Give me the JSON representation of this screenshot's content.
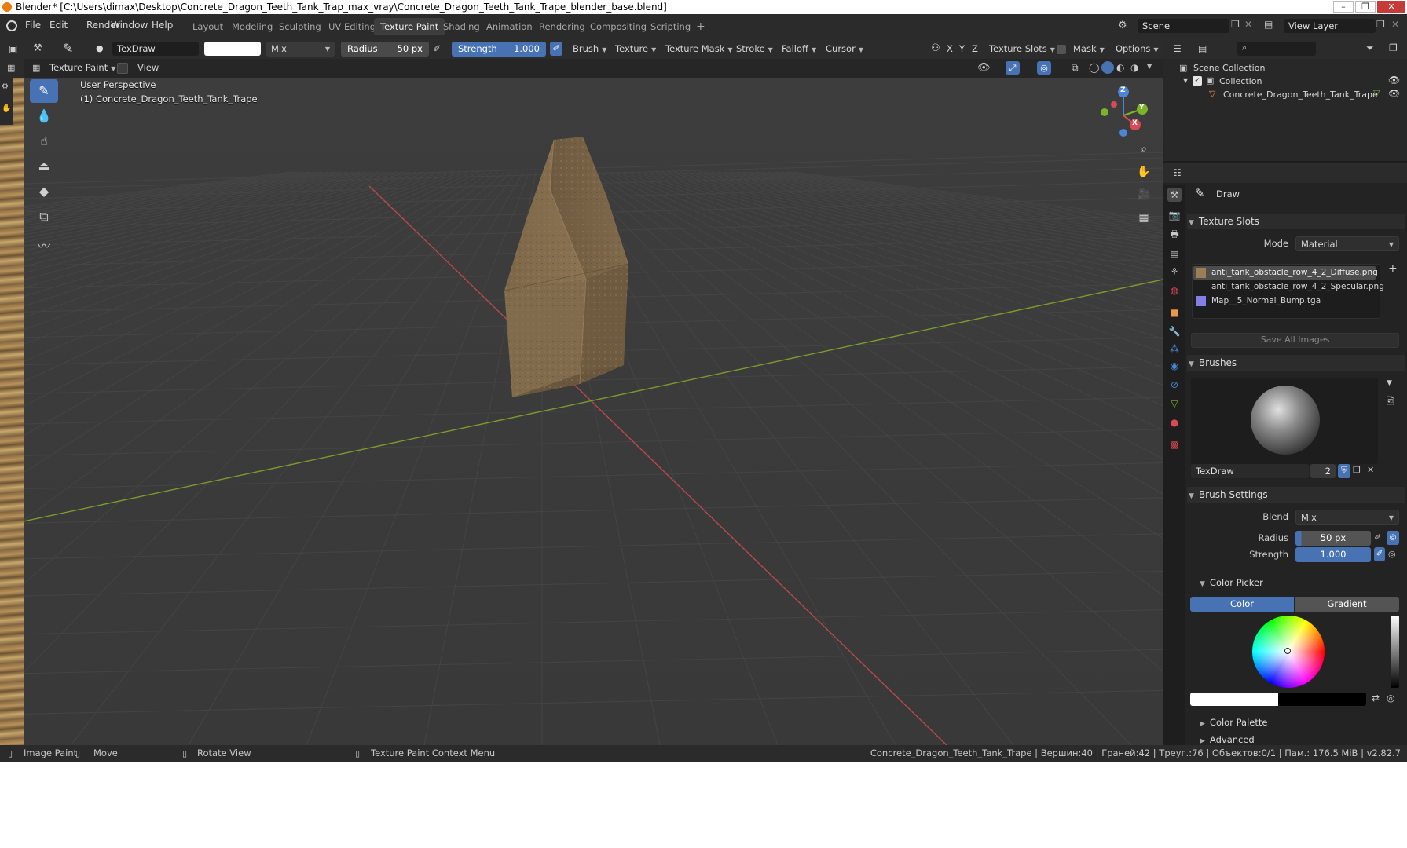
{
  "titlebar": {
    "title": "Blender* [C:\\Users\\dimax\\Desktop\\Concrete_Dragon_Teeth_Tank_Trap_max_vray\\Concrete_Dragon_Teeth_Tank_Trape_blender_base.blend]"
  },
  "menu": {
    "file": "File",
    "edit": "Edit",
    "render": "Render",
    "window": "Window",
    "help": "Help"
  },
  "workspaces": [
    "Layout",
    "Modeling",
    "Sculpting",
    "UV Editing",
    "Texture Paint",
    "Shading",
    "Animation",
    "Rendering",
    "Compositing",
    "Scripting"
  ],
  "workspace_add": "+",
  "scene": {
    "name": "Scene",
    "view_layer": "View Layer"
  },
  "tool_header": {
    "brush_name": "TexDraw",
    "blend": "Mix",
    "radius_label": "Radius",
    "radius_value": "50 px",
    "strength_label": "Strength",
    "strength_value": "1.000",
    "brush": "Brush",
    "texture": "Texture",
    "texture_mask": "Texture Mask",
    "stroke": "Stroke",
    "falloff": "Falloff",
    "cursor": "Cursor",
    "axis_x": "X",
    "axis_y": "Y",
    "axis_z": "Z",
    "texture_slots": "Texture Slots",
    "mask": "Mask",
    "options": "Options"
  },
  "viewport_header": {
    "mode": "Texture Paint",
    "view": "View"
  },
  "viewport": {
    "perspective": "User Perspective",
    "object_label": "(1) Concrete_Dragon_Teeth_Tank_Trape"
  },
  "gizmo": {
    "x": "X",
    "y": "Y",
    "z": "Z"
  },
  "outliner": {
    "scene_collection": "Scene Collection",
    "collection": "Collection",
    "object": "Concrete_Dragon_Teeth_Tank_Trape"
  },
  "properties": {
    "tool_name": "Draw",
    "texture_slots_title": "Texture Slots",
    "mode_label": "Mode",
    "mode_value": "Material",
    "slots": [
      "anti_tank_obstacle_row_4_2_Diffuse.png",
      "anti_tank_obstacle_row_4_2_Specular.png",
      "Map__5_Normal_Bump.tga"
    ],
    "save_all_images": "Save All Images",
    "brushes_title": "Brushes",
    "brush_name": "TexDraw",
    "brush_users": "2",
    "brush_settings_title": "Brush Settings",
    "blend_label": "Blend",
    "blend_value": "Mix",
    "radius_label": "Radius",
    "radius_value": "50 px",
    "strength_label": "Strength",
    "strength_value": "1.000",
    "color_picker_title": "Color Picker",
    "color_tab": "Color",
    "gradient_tab": "Gradient",
    "color_palette": "Color Palette",
    "advanced": "Advanced"
  },
  "statusbar": {
    "image_paint": "Image Paint",
    "move": "Move",
    "rotate_view": "Rotate View",
    "context_menu": "Texture Paint Context Menu",
    "stats": "Concrete_Dragon_Teeth_Tank_Trape | Вершин:40 | Граней:42 | Треуг.:76 | Объектов:0/1 | Пам.: 176.5 MiB | v2.82.7"
  },
  "colors": {
    "accent": "#4772b3",
    "viewport_bg": "#3c3c3c",
    "grid_x_axis": "#b8484f",
    "grid_y_axis": "#7d9a2c",
    "primary_color": "#ffffff"
  }
}
